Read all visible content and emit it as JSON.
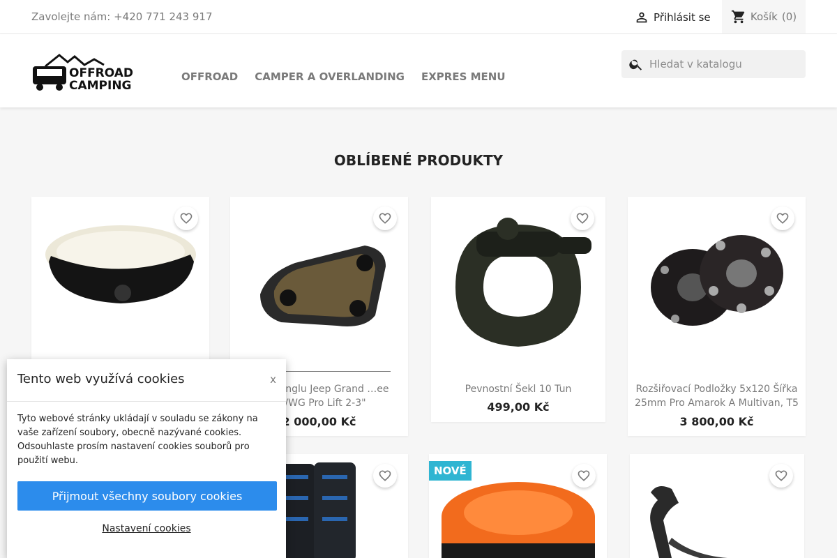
{
  "topbar": {
    "contact": "Zavolejte nám: +420 771 243 917",
    "signin_label": "Přihlásit se",
    "cart_label": "Košík",
    "cart_count": "(0)"
  },
  "header": {
    "logo_alt": "OFFROAD CAMPING",
    "logo_line1": "OFFROAD",
    "logo_line2": "CAMPING",
    "nav": [
      "OFFROAD",
      "CAMPER A OVERLANDING",
      "EXPRES MENU"
    ],
    "search_placeholder": "Hledat v katalogu"
  },
  "section_title": "OBLÍBENÉ PRODUKTY",
  "products": [
    {
      "name": "",
      "price": ""
    },
    {
      "name": "…a Trianglu Jeep Grand …ee WJ/WG Pro Lift 2-3\"",
      "price": "2 000,00 Kč"
    },
    {
      "name": "Pevnostní Šekl 10 Tun",
      "price": "499,00 Kč"
    },
    {
      "name": "Rozšiřovací Podložky 5x120 Šířka 25mm Pro Amarok A Multivan, T5",
      "price": "3 800,00 Kč"
    }
  ],
  "badges": {
    "new": "NOVÉ"
  },
  "cookie": {
    "title": "Tento web využívá cookies",
    "close": "x",
    "body": "Tyto webové stránky ukládají v souladu se zákony na vaše zařízení soubory, obecně nazývané cookies. Odsouhlaste prosím nastavení cookies souborů pro použití webu.",
    "accept": "Přijmout všechny soubory cookies",
    "settings": "Nastavení cookies"
  },
  "colors": {
    "accent": "#2c8cec",
    "badge": "#2fb5d2",
    "text": "#232323",
    "muted": "#7a7a7a"
  }
}
